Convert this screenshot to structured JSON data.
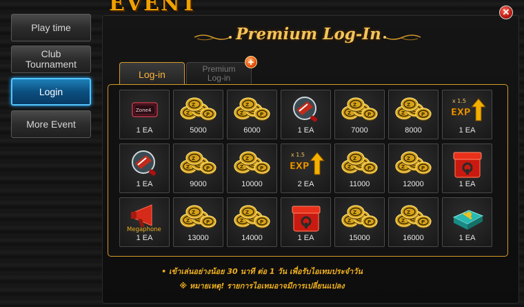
{
  "event_title": "EVENT",
  "sidebar": {
    "items": [
      {
        "label": "Play time",
        "active": false
      },
      {
        "label": "Club\nTournament",
        "active": false
      },
      {
        "label": "Login",
        "active": true
      },
      {
        "label": "More Event",
        "active": false
      }
    ]
  },
  "header": {
    "title": "Premium Log-In"
  },
  "tabs": [
    {
      "label": "Log-in",
      "active": true
    },
    {
      "label": "Premium\nLog-in",
      "active": false
    }
  ],
  "rewards": [
    {
      "icon": "zone4-ticket-icon",
      "qty": "1 EA"
    },
    {
      "icon": "zp-coins-icon",
      "qty": "5000"
    },
    {
      "icon": "zp-coins-icon",
      "qty": "6000"
    },
    {
      "icon": "magnifier-capsule-icon",
      "qty": "1 EA"
    },
    {
      "icon": "zp-coins-icon",
      "qty": "7000"
    },
    {
      "icon": "zp-coins-icon",
      "qty": "8000"
    },
    {
      "icon": "exp-boost-icon",
      "qty": "1 EA",
      "caption": "x 1.5"
    },
    {
      "icon": "magnifier-capsule-icon",
      "qty": "1 EA"
    },
    {
      "icon": "zp-coins-icon",
      "qty": "9000"
    },
    {
      "icon": "zp-coins-icon",
      "qty": "10000"
    },
    {
      "icon": "exp-boost-icon",
      "qty": "2 EA",
      "caption": "x 1.5"
    },
    {
      "icon": "zp-coins-icon",
      "qty": "11000"
    },
    {
      "icon": "zp-coins-icon",
      "qty": "12000"
    },
    {
      "icon": "red-mystery-box-icon",
      "qty": "1 EA"
    },
    {
      "icon": "megaphone-icon",
      "qty": "1 EA",
      "caption": "Megaphone"
    },
    {
      "icon": "zp-coins-icon",
      "qty": "13000"
    },
    {
      "icon": "zp-coins-icon",
      "qty": "14000"
    },
    {
      "icon": "red-mystery-box-icon",
      "qty": "1 EA"
    },
    {
      "icon": "zp-coins-icon",
      "qty": "15000"
    },
    {
      "icon": "zp-coins-icon",
      "qty": "16000"
    },
    {
      "icon": "teal-gift-box-icon",
      "qty": "1 EA"
    }
  ],
  "ticket_label": "Zone4",
  "zp_letters": [
    "Z",
    "P"
  ],
  "exp_label": "EXP",
  "notices": [
    "• เข้าเล่นอย่างน้อย 30 นาที ต่อ 1 วัน เพื่อรับไอเทมประจำวัน",
    "※ หมายเหตุ! รายการไอเทมอาจมีการเปลี่ยนแปลง"
  ],
  "colors": {
    "accent_gold": "#d89b2a",
    "active_blue": "#53c6ff",
    "close_red": "#b81a10"
  }
}
